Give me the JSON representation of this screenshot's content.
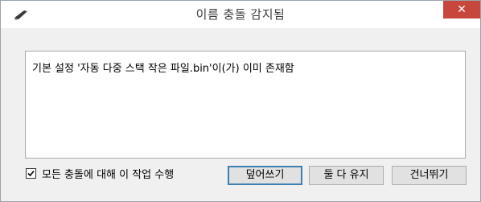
{
  "dialog": {
    "title": "이름 충돌 감지됨",
    "close_label": "✕",
    "message": "기본 설정 '자동 다중 스택 작은 파일.bin'이(가) 이미 존재함",
    "apply_all_label": "모든 충돌에 대해 이 작업 수행",
    "apply_all_checked": true,
    "buttons": {
      "overwrite": "덮어쓰기",
      "keep_both": "둘 다 유지",
      "skip": "건너뛰기"
    }
  },
  "colors": {
    "close_button": "#c7473d",
    "focus_border": "#3c7fb1",
    "dialog_background": "#f0f0f0"
  },
  "icons": {
    "app": "feather-scanner-icon",
    "close": "close-icon",
    "checkmark": "checkmark-icon"
  }
}
